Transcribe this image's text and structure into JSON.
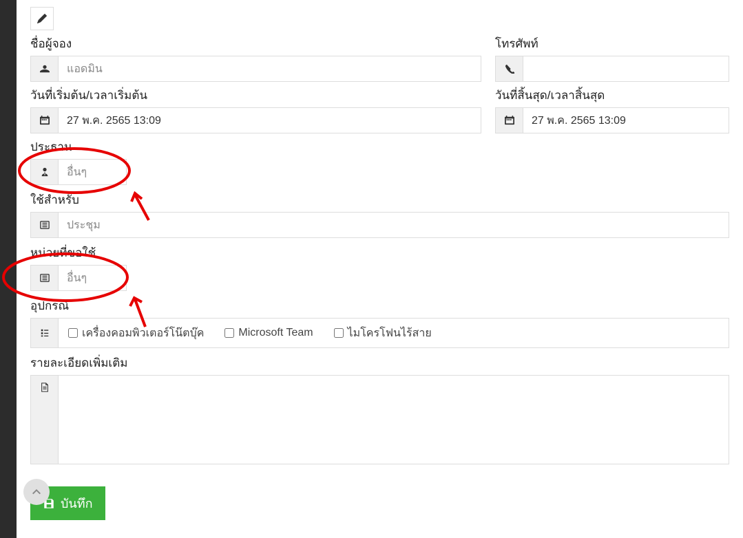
{
  "labels": {
    "booker_name": "ชื่อผู้จอง",
    "phone": "โทรศัพท์",
    "start_datetime": "วันที่เริ่มต้น/เวลาเริ่มต้น",
    "end_datetime": "วันที่สิ้นสุด/เวลาสิ้นสุด",
    "chairman": "ประธาน",
    "use_for": "ใช้สำหรับ",
    "requesting_unit": "หน่วยที่ขอใช้",
    "equipment": "อุปกรณ์",
    "additional_details": "รายละเอียดเพิ่มเติม"
  },
  "values": {
    "booker_name": "แอดมิน",
    "phone": "",
    "start_datetime": "27 พ.ค. 2565 13:09",
    "end_datetime": "27 พ.ค. 2565 13:09",
    "chairman": "อื่นๆ",
    "use_for": "ประชุม",
    "requesting_unit": "อื่นๆ",
    "additional_details": ""
  },
  "equipment_options": [
    {
      "label": "เครื่องคอมพิวเตอร์โน๊ตบุ๊ค",
      "checked": false
    },
    {
      "label": "Microsoft Team",
      "checked": false
    },
    {
      "label": "ไมโครโฟนไร้สาย",
      "checked": false
    }
  ],
  "buttons": {
    "save": "บันทึก"
  }
}
